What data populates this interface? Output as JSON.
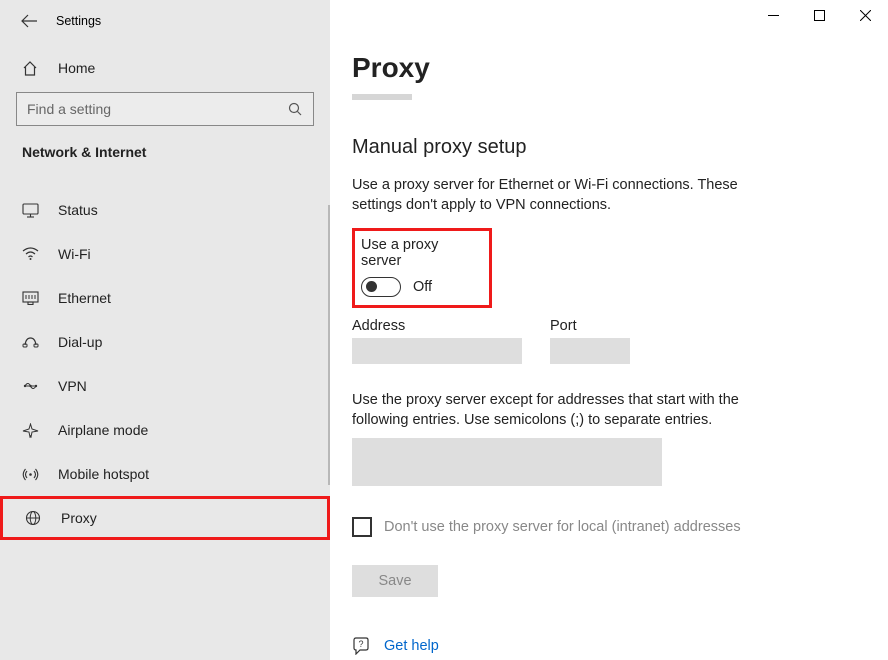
{
  "titlebar": {
    "title": "Settings"
  },
  "sidebar": {
    "home_label": "Home",
    "search_placeholder": "Find a setting",
    "section_title": "Network & Internet",
    "items": [
      {
        "label": "Status"
      },
      {
        "label": "Wi-Fi"
      },
      {
        "label": "Ethernet"
      },
      {
        "label": "Dial-up"
      },
      {
        "label": "VPN"
      },
      {
        "label": "Airplane mode"
      },
      {
        "label": "Mobile hotspot"
      },
      {
        "label": "Proxy"
      }
    ]
  },
  "main": {
    "page_title": "Proxy",
    "section_title": "Manual proxy setup",
    "description": "Use a proxy server for Ethernet or Wi-Fi connections. These settings don't apply to VPN connections.",
    "toggle_label": "Use a proxy server",
    "toggle_state": "Off",
    "address_label": "Address",
    "port_label": "Port",
    "address_value": "",
    "port_value": "",
    "exceptions_text": "Use the proxy server except for addresses that start with the following entries. Use semicolons (;) to separate entries.",
    "exceptions_value": "",
    "local_bypass_label": "Don't use the proxy server for local (intranet) addresses",
    "save_label": "Save",
    "help_label": "Get help"
  }
}
